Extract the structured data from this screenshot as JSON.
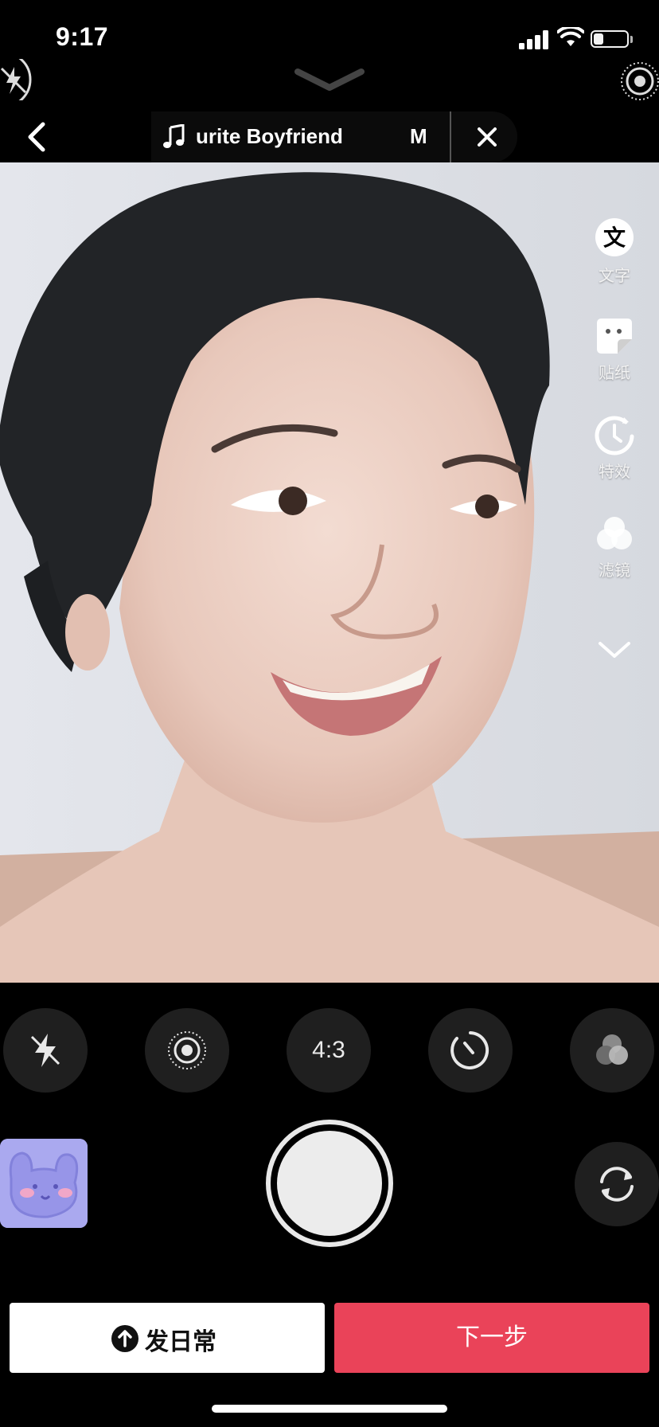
{
  "status_bar": {
    "time": "9:17",
    "battery_level": 0.3
  },
  "icons": {
    "top_left": "flash-off-icon",
    "top_right": "live-photo-icon",
    "collapse": "chevron-down-icon",
    "back": "back-chevron-icon",
    "music": "music-note-icon",
    "close": "close-icon"
  },
  "header": {
    "music_title": "urite Boyfriend",
    "music_suffix": "M"
  },
  "side_tools": [
    {
      "icon": "text-icon",
      "label": "文字"
    },
    {
      "icon": "sticker-icon",
      "label": "贴纸"
    },
    {
      "icon": "effects-icon",
      "label": "特效"
    },
    {
      "icon": "filter-icon",
      "label": "滤镜"
    },
    {
      "icon": "chevron-down-icon",
      "label": ""
    }
  ],
  "controls": {
    "flash": "flash-off-icon",
    "live": "live-photo-icon",
    "ratio_label": "4:3",
    "timer": "timer-icon",
    "filter": "filter-icon"
  },
  "bottom": {
    "post_daily_label": "发日常",
    "next_step_label": "下一步"
  },
  "colors": {
    "accent": "#ea4359",
    "background": "#000000"
  }
}
